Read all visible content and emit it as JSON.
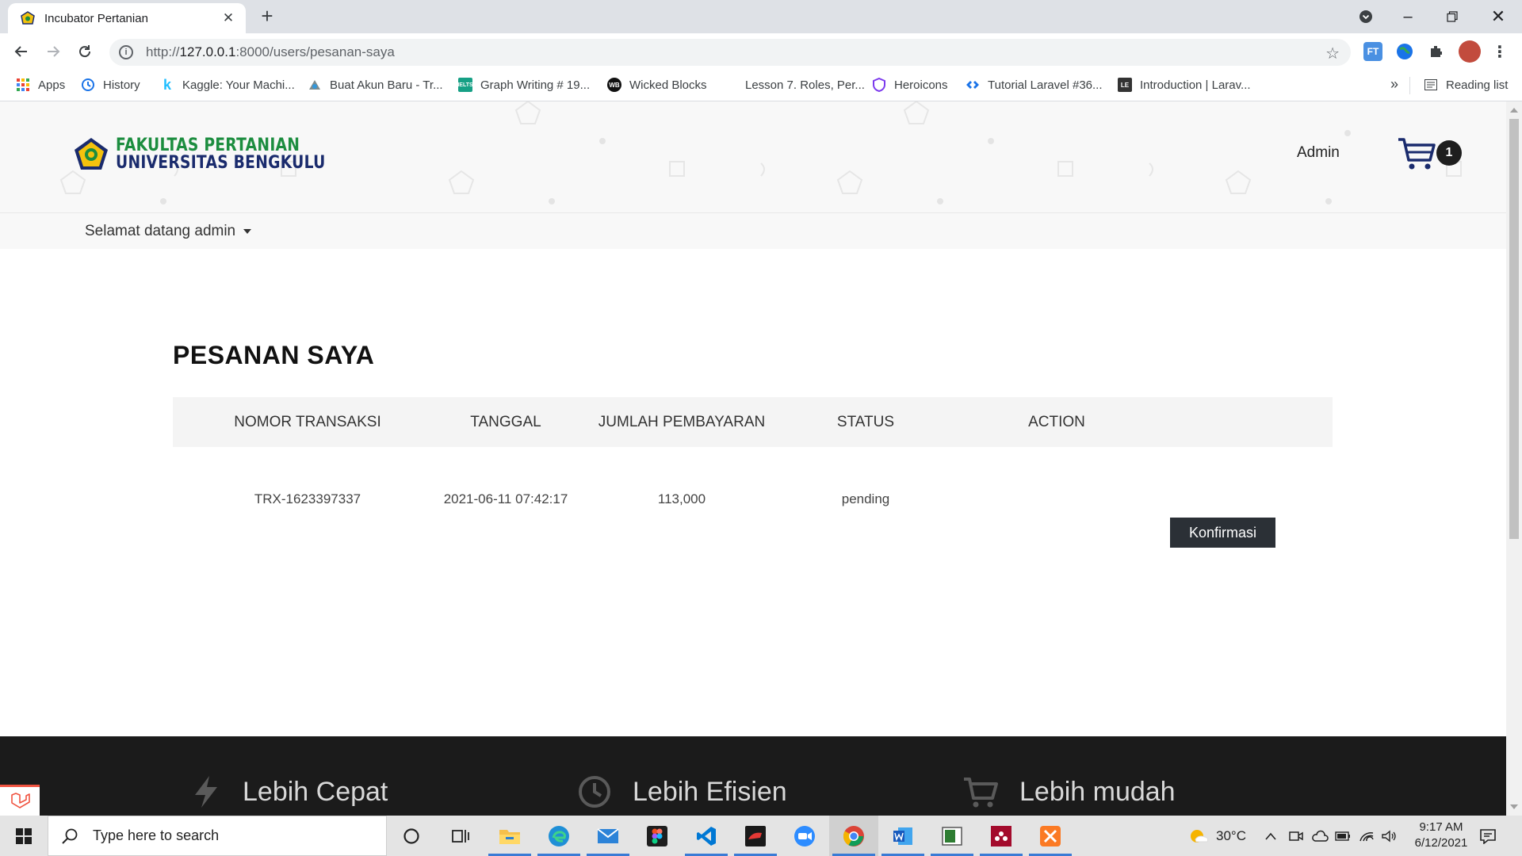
{
  "browser": {
    "tab_title": "Incubator Pertanian",
    "url_host": "127.0.0.1",
    "url_prefix": "http://",
    "url_rest": ":8000/users/pesanan-saya",
    "bookmarks": [
      {
        "label": "Apps",
        "icon": "apps-grid-icon"
      },
      {
        "label": "History",
        "icon": "history-icon"
      },
      {
        "label": "Kaggle: Your Machi...",
        "icon": "kaggle-icon"
      },
      {
        "label": "Buat Akun Baru - Tr...",
        "icon": "account-icon"
      },
      {
        "label": "Graph Writing # 19...",
        "icon": "ielts-icon"
      },
      {
        "label": "Wicked Blocks",
        "icon": "wicked-blocks-icon"
      },
      {
        "label": "Lesson 7. Roles, Per...",
        "icon": "blank-page-icon"
      },
      {
        "label": "Heroicons",
        "icon": "heroicons-icon"
      },
      {
        "label": "Tutorial Laravel #36...",
        "icon": "tutorial-icon"
      },
      {
        "label": "Introduction | Larav...",
        "icon": "laravel-doc-icon"
      }
    ],
    "bookmarks_more": "»",
    "reading_list": "Reading list"
  },
  "site": {
    "logo_line1": "FAKULTAS PERTANIAN",
    "logo_line2": "UNIVERSITAS BENGKULU",
    "nav_admin": "Admin",
    "cart_count": "1",
    "welcome": "Selamat datang admin"
  },
  "orders": {
    "title": "PESANAN SAYA",
    "columns": [
      "NOMOR TRANSAKSI",
      "TANGGAL",
      "JUMLAH PEMBAYARAN",
      "STATUS",
      "ACTION"
    ],
    "rows": [
      {
        "nomor": "TRX-1623397337",
        "tanggal": "2021-06-11 07:42:17",
        "jumlah": "113,000",
        "status": "pending",
        "action": "Konfirmasi"
      }
    ]
  },
  "footer": {
    "features": [
      {
        "label": "Lebih Cepat",
        "icon": "lightning-icon"
      },
      {
        "label": "Lebih Efisien",
        "icon": "clock-icon"
      },
      {
        "label": "Lebih mudah",
        "icon": "cart-icon"
      }
    ]
  },
  "taskbar": {
    "search_placeholder": "Type here to search",
    "temperature": "30°C",
    "time": "9:17 AM",
    "date": "6/12/2021"
  },
  "colors": {
    "logo_green": "#1c8d3f",
    "logo_navy": "#1a2b6d",
    "footer_bg": "#1b1b1b",
    "button_dark": "#2b3036"
  }
}
